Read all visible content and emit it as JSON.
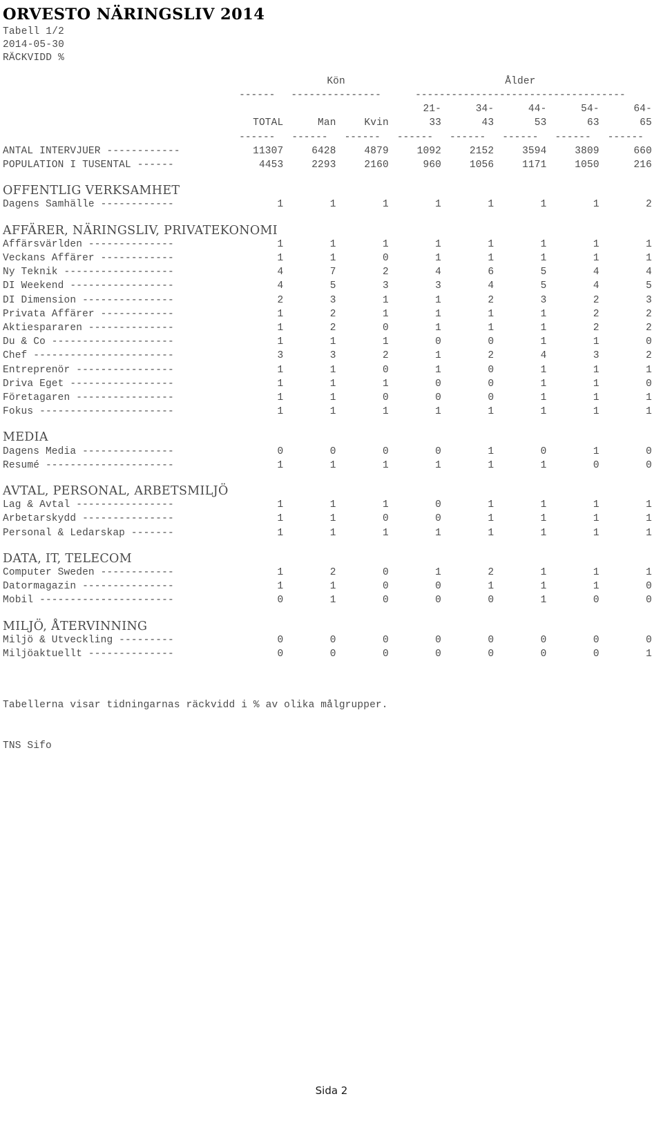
{
  "document": {
    "title": "ORVESTO NÄRINGSLIV 2014",
    "table_ref": "Tabell 1/2",
    "date": "2014-05-30",
    "measure": "RÄCKVIDD %",
    "footnote": "Tabellerna visar tidningarnas räckvidd i % av olika målgrupper.",
    "source": "TNS Sifo",
    "page_label": "Sida 2"
  },
  "table": {
    "group_headers": [
      {
        "label": "",
        "span": 1
      },
      {
        "label": "Kön",
        "span": 2
      },
      {
        "label": "Ålder",
        "span": 5
      }
    ],
    "group_rules": [
      "------",
      "---------------",
      "-----------------------------------"
    ],
    "columns": [
      {
        "top": "",
        "name": "TOTAL"
      },
      {
        "top": "",
        "name": "Man"
      },
      {
        "top": "",
        "name": "Kvin"
      },
      {
        "top": "21-",
        "name": "33"
      },
      {
        "top": "34-",
        "name": "43"
      },
      {
        "top": "44-",
        "name": "53"
      },
      {
        "top": "54-",
        "name": "63"
      },
      {
        "top": "64-",
        "name": "65"
      }
    ],
    "column_rule": "------",
    "base_rows": [
      {
        "label": "ANTAL INTERVJUER ------------",
        "values": [
          "11307",
          "6428",
          "4879",
          "1092",
          "2152",
          "3594",
          "3809",
          "660"
        ]
      },
      {
        "label": "POPULATION I TUSENTAL ------",
        "values": [
          "4453",
          "2293",
          "2160",
          "960",
          "1056",
          "1171",
          "1050",
          "216"
        ]
      }
    ],
    "sections": [
      {
        "title": "OFFENTLIG VERKSAMHET",
        "rows": [
          {
            "label": "Dagens Samhälle ------------",
            "values": [
              "1",
              "1",
              "1",
              "1",
              "1",
              "1",
              "1",
              "2"
            ]
          }
        ]
      },
      {
        "title": "AFFÄRER, NÄRINGSLIV, PRIVATEKONOMI",
        "rows": [
          {
            "label": "Affärsvärlden --------------",
            "values": [
              "1",
              "1",
              "1",
              "1",
              "1",
              "1",
              "1",
              "1"
            ]
          },
          {
            "label": "Veckans Affärer ------------",
            "values": [
              "1",
              "1",
              "0",
              "1",
              "1",
              "1",
              "1",
              "1"
            ]
          },
          {
            "label": "Ny Teknik ------------------",
            "values": [
              "4",
              "7",
              "2",
              "4",
              "6",
              "5",
              "4",
              "4"
            ]
          },
          {
            "label": "DI Weekend -----------------",
            "values": [
              "4",
              "5",
              "3",
              "3",
              "4",
              "5",
              "4",
              "5"
            ]
          },
          {
            "label": "DI Dimension ---------------",
            "values": [
              "2",
              "3",
              "1",
              "1",
              "2",
              "3",
              "2",
              "3"
            ]
          },
          {
            "label": "Privata Affärer ------------",
            "values": [
              "1",
              "2",
              "1",
              "1",
              "1",
              "1",
              "2",
              "2"
            ]
          },
          {
            "label": "Aktiespararen --------------",
            "values": [
              "1",
              "2",
              "0",
              "1",
              "1",
              "1",
              "2",
              "2"
            ]
          },
          {
            "label": "Du & Co --------------------",
            "values": [
              "1",
              "1",
              "1",
              "0",
              "0",
              "1",
              "1",
              "0"
            ]
          },
          {
            "label": "Chef -----------------------",
            "values": [
              "3",
              "3",
              "2",
              "1",
              "2",
              "4",
              "3",
              "2"
            ]
          },
          {
            "label": "Entreprenör ----------------",
            "values": [
              "1",
              "1",
              "0",
              "1",
              "0",
              "1",
              "1",
              "1"
            ]
          },
          {
            "label": "Driva Eget -----------------",
            "values": [
              "1",
              "1",
              "1",
              "0",
              "0",
              "1",
              "1",
              "0"
            ]
          },
          {
            "label": "Företagaren ----------------",
            "values": [
              "1",
              "1",
              "0",
              "0",
              "0",
              "1",
              "1",
              "1"
            ]
          },
          {
            "label": "Fokus ----------------------",
            "values": [
              "1",
              "1",
              "1",
              "1",
              "1",
              "1",
              "1",
              "1"
            ]
          }
        ]
      },
      {
        "title": "MEDIA",
        "rows": [
          {
            "label": "Dagens Media ---------------",
            "values": [
              "0",
              "0",
              "0",
              "0",
              "1",
              "0",
              "1",
              "0"
            ]
          },
          {
            "label": "Resumé ---------------------",
            "values": [
              "1",
              "1",
              "1",
              "1",
              "1",
              "1",
              "0",
              "0"
            ]
          }
        ]
      },
      {
        "title": "AVTAL, PERSONAL, ARBETSMILJÖ",
        "rows": [
          {
            "label": "Lag & Avtal ----------------",
            "values": [
              "1",
              "1",
              "1",
              "0",
              "1",
              "1",
              "1",
              "1"
            ]
          },
          {
            "label": "Arbetarskydd ---------------",
            "values": [
              "1",
              "1",
              "0",
              "0",
              "1",
              "1",
              "1",
              "1"
            ]
          },
          {
            "label": "Personal & Ledarskap -------",
            "values": [
              "1",
              "1",
              "1",
              "1",
              "1",
              "1",
              "1",
              "1"
            ]
          }
        ]
      },
      {
        "title": "DATA, IT, TELECOM",
        "rows": [
          {
            "label": "Computer Sweden ------------",
            "values": [
              "1",
              "2",
              "0",
              "1",
              "2",
              "1",
              "1",
              "1"
            ]
          },
          {
            "label": "Datormagazin ---------------",
            "values": [
              "1",
              "1",
              "0",
              "0",
              "1",
              "1",
              "1",
              "0"
            ]
          },
          {
            "label": "Mobil ----------------------",
            "values": [
              "0",
              "1",
              "0",
              "0",
              "0",
              "1",
              "0",
              "0"
            ]
          }
        ]
      },
      {
        "title": "MILJÖ, ÅTERVINNING",
        "rows": [
          {
            "label": "Miljö & Utveckling ---------",
            "values": [
              "0",
              "0",
              "0",
              "0",
              "0",
              "0",
              "0",
              "0"
            ]
          },
          {
            "label": "Miljöaktuellt --------------",
            "values": [
              "0",
              "0",
              "0",
              "0",
              "0",
              "0",
              "0",
              "1"
            ]
          }
        ]
      }
    ]
  }
}
